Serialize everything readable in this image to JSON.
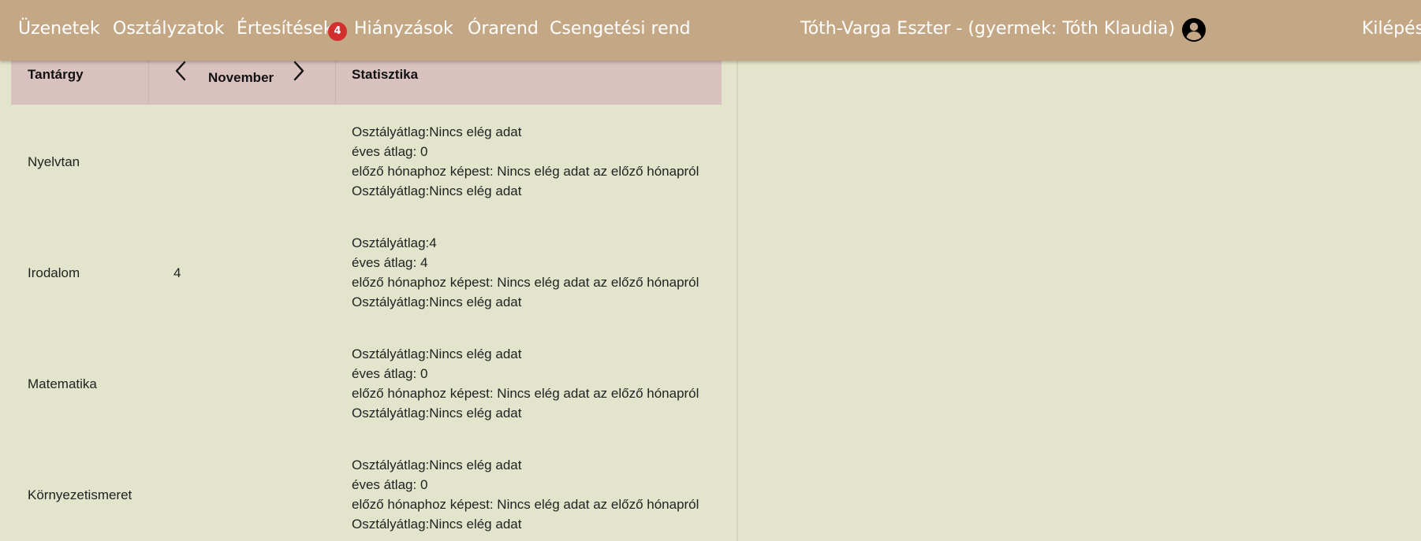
{
  "nav": {
    "items": [
      "Üzenetek",
      "Osztályzatok",
      "Értesítések",
      "Hiányzások",
      "Órarend",
      "Csengetési rend"
    ],
    "notification_count": "4",
    "user": "Tóth-Varga Eszter - (gyermek: Tóth Klaudia)",
    "avatar_icon": "account-circle-icon",
    "logout": "Kilépés"
  },
  "colors": {
    "navbar": "#c4a885",
    "background": "#e2e4cb",
    "table_header": "#d9c1bf",
    "badge": "#d32f2f"
  },
  "table": {
    "headers": {
      "subject": "Tantárgy",
      "month": "November",
      "stats": "Statisztika"
    },
    "prev_icon": "chevron-left-icon",
    "next_icon": "chevron-right-icon",
    "rows": [
      {
        "subject": "Nyelvtan",
        "grades": "",
        "stats": [
          "Osztályátlag:Nincs elég adat",
          "éves átlag: 0",
          "előző hónaphoz képest: Nincs elég adat az előző hónapról",
          "Osztályátlag:Nincs elég adat"
        ]
      },
      {
        "subject": "Irodalom",
        "grades": "4",
        "stats": [
          "Osztályátlag:4",
          "éves átlag: 4",
          "előző hónaphoz képest: Nincs elég adat az előző hónapról",
          "Osztályátlag:Nincs elég adat"
        ]
      },
      {
        "subject": "Matematika",
        "grades": "",
        "stats": [
          "Osztályátlag:Nincs elég adat",
          "éves átlag: 0",
          "előző hónaphoz képest: Nincs elég adat az előző hónapról",
          "Osztályátlag:Nincs elég adat"
        ]
      },
      {
        "subject": "Környezetismeret",
        "grades": "",
        "stats": [
          "Osztályátlag:Nincs elég adat",
          "éves átlag: 0",
          "előző hónaphoz képest: Nincs elég adat az előző hónapról",
          "Osztályátlag:Nincs elég adat"
        ]
      }
    ]
  }
}
